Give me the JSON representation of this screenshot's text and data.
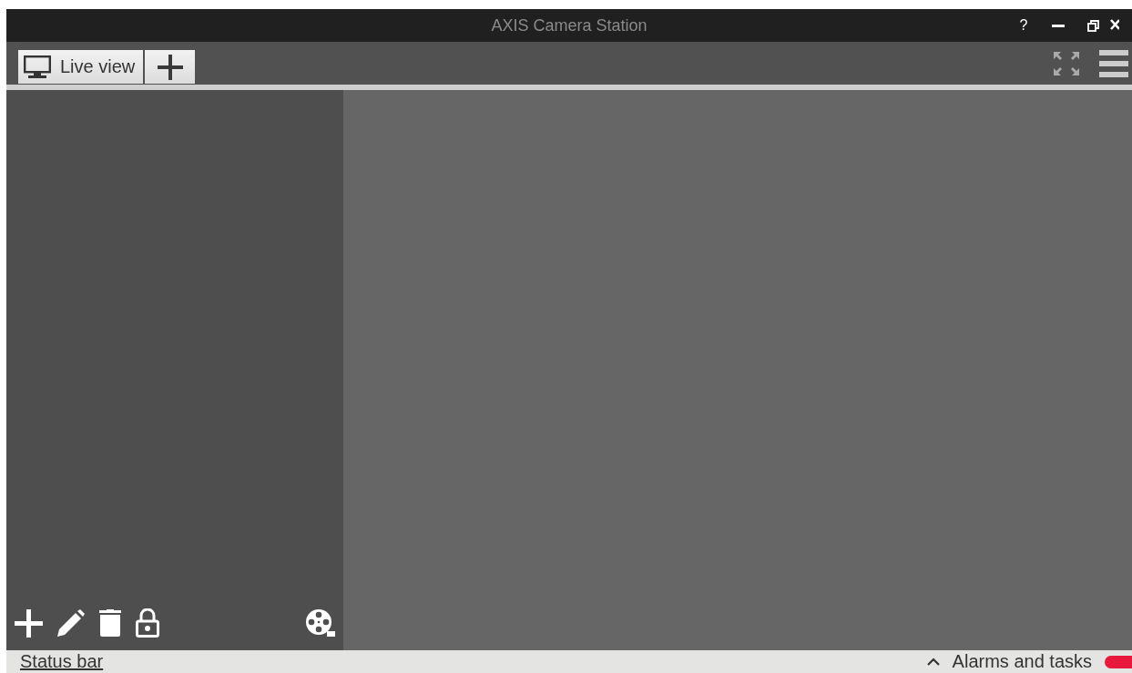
{
  "window": {
    "title": "AXIS Camera Station",
    "help": "?"
  },
  "tabs": [
    {
      "label": "Live view",
      "selected": true
    }
  ],
  "status_bar": {
    "link": "Status bar",
    "alarms": "Alarms and tasks",
    "indicators": [
      {
        "color": "#e8193c"
      }
    ]
  }
}
